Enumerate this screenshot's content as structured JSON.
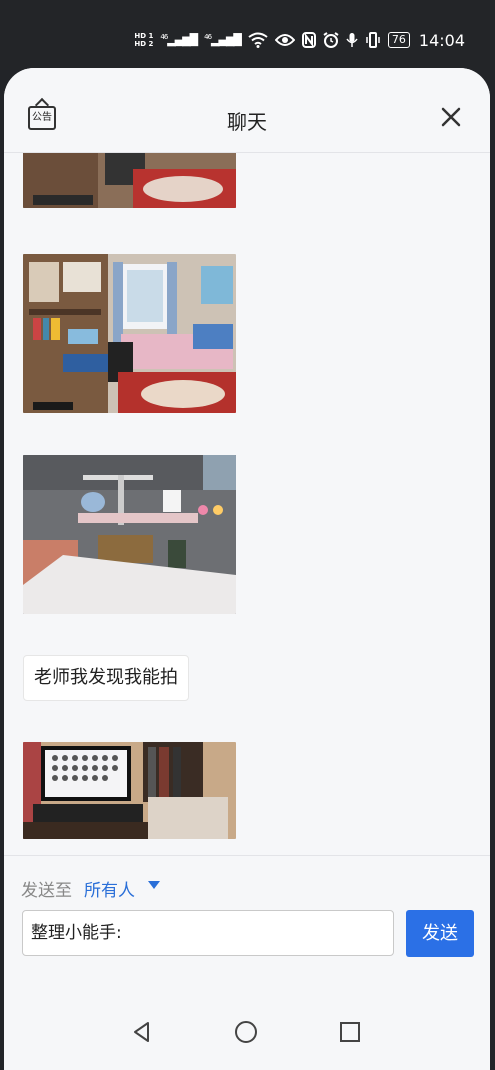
{
  "status_bar": {
    "hd1": "HD 1",
    "hd2": "HD 2",
    "signal1": "46",
    "signal2": "46",
    "battery": "76",
    "time": "14:04"
  },
  "header": {
    "notice_label": "公告",
    "title": "聊天"
  },
  "messages": {
    "text_message": "老师我发现我能拍"
  },
  "compose": {
    "send_to_label": "发送至",
    "send_to_value": "所有人",
    "input_value": "整理小能手:",
    "send_button": "发送"
  },
  "colors": {
    "accent": "#2b70e6",
    "link": "#2a6fd8"
  },
  "icons": {
    "notice": "notice-board-icon",
    "close": "close-icon",
    "back": "back-triangle-icon",
    "home": "home-circle-icon",
    "recents": "recents-square-icon"
  }
}
